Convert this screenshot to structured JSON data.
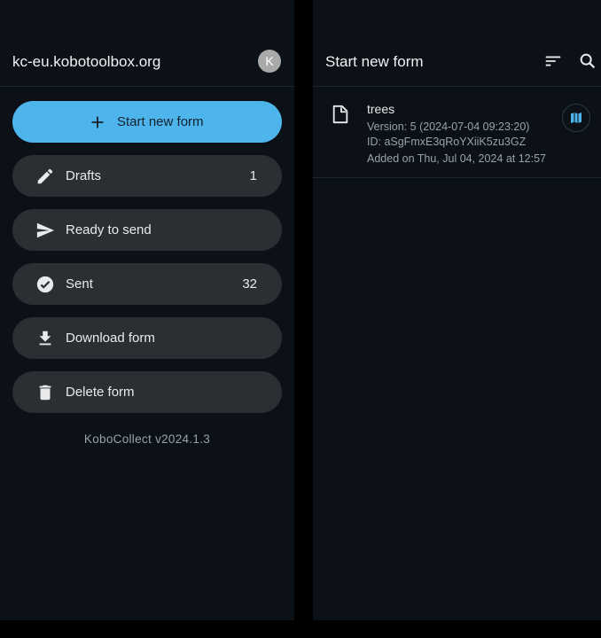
{
  "drawer": {
    "server_url": "kc-eu.kobotoolbox.org",
    "avatar_letter": "K",
    "buttons": [
      {
        "label": "Start new form",
        "icon": "plus-icon"
      },
      {
        "label": "Drafts",
        "count": "1",
        "icon": "pencil-icon"
      },
      {
        "label": "Ready to send",
        "icon": "send-icon"
      },
      {
        "label": "Sent",
        "count": "32",
        "icon": "check-circle-icon"
      },
      {
        "label": "Download form",
        "icon": "download-icon"
      },
      {
        "label": "Delete form",
        "icon": "trash-icon"
      }
    ],
    "version": "KoboCollect v2024.1.3"
  },
  "form_list": {
    "title": "Start new form",
    "toolbar_icons": [
      "sort-icon",
      "search-icon"
    ],
    "forms": [
      {
        "name": "trees",
        "version": "Version: 5 (2024-07-04 09:23:20)",
        "id": "ID: aSgFmxE3qRoYXiiK5zu3GZ",
        "added": "Added on Thu, Jul 04, 2024 at 12:57"
      }
    ]
  },
  "colors": {
    "background": "#0b1117",
    "primary": "#4eb4ec",
    "button": "#2b2f33",
    "map_icon": "#4eb4ec"
  }
}
